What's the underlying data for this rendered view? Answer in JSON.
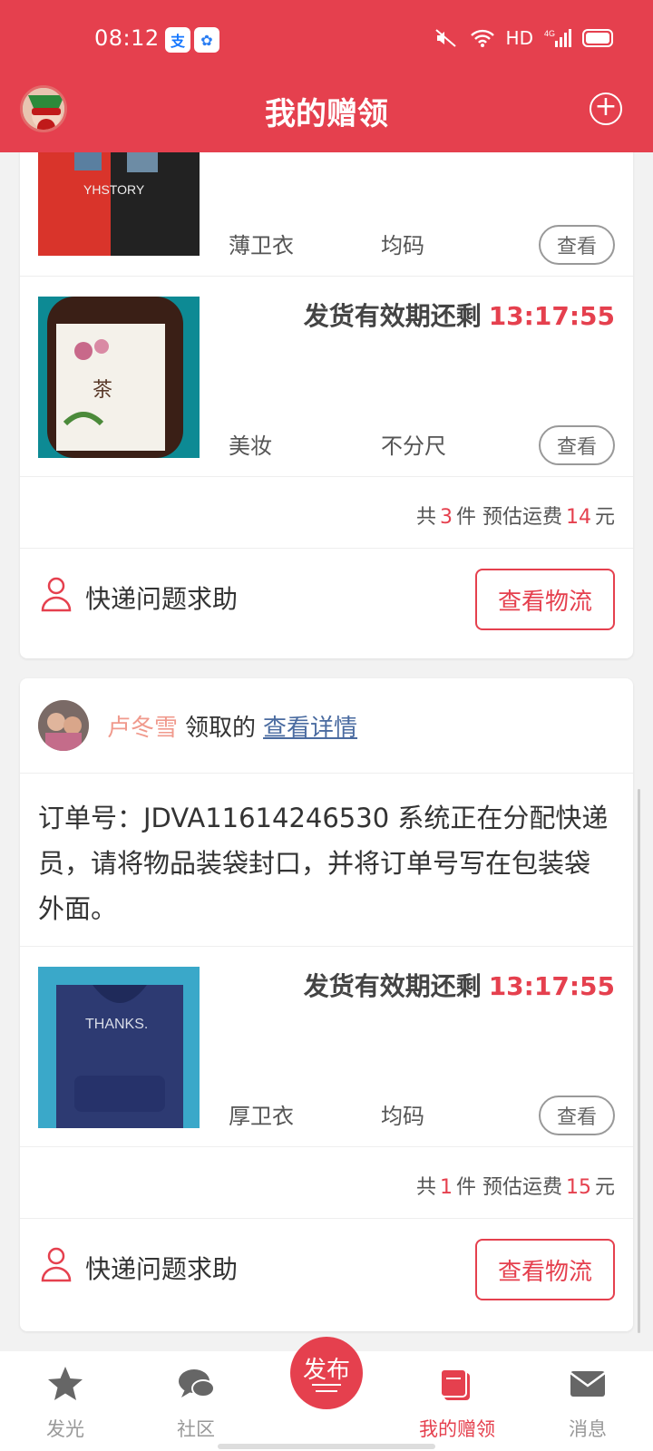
{
  "status_bar": {
    "time": "08:12",
    "network": "HD",
    "signal": "4G"
  },
  "header": {
    "title": "我的赠领"
  },
  "card1": {
    "items": [
      {
        "category": "薄卫衣",
        "size": "均码",
        "view_label": "查看"
      },
      {
        "deadline_label": "发货有效期还剩",
        "deadline_time": "13:17:55",
        "category": "美妆",
        "size": "不分尺",
        "view_label": "查看"
      }
    ],
    "summary": {
      "prefix": "共",
      "count": "3",
      "unit": "件 预估运费",
      "fee": "14",
      "currency": "元"
    },
    "help_label": "快递问题求助",
    "logistics_label": "查看物流"
  },
  "card2": {
    "claimer": "卢冬雪",
    "claim_verb": "领取的",
    "detail_link": "查看详情",
    "order_note": "订单号：JDVA11614246530 系统正在分配快递员，请将物品装袋封口，并将订单号写在包装袋外面。",
    "item": {
      "deadline_label": "发货有效期还剩",
      "deadline_time": "13:17:55",
      "category": "厚卫衣",
      "size": "均码",
      "view_label": "查看"
    },
    "summary": {
      "prefix": "共",
      "count": "1",
      "unit": "件 预估运费",
      "fee": "15",
      "currency": "元"
    },
    "help_label": "快递问题求助",
    "logistics_label": "查看物流"
  },
  "bottom_nav": {
    "items": [
      {
        "label": "发光",
        "icon": "star-icon"
      },
      {
        "label": "社区",
        "icon": "chat-bubbles-icon"
      },
      {
        "label": "发布",
        "icon": "publish-icon"
      },
      {
        "label": "我的赠领",
        "icon": "gift-box-icon",
        "active": true
      },
      {
        "label": "消息",
        "icon": "envelope-icon"
      }
    ]
  },
  "colors": {
    "brand": "#e5404e",
    "link": "#4a6ba0",
    "claimer": "#f09a8d"
  }
}
